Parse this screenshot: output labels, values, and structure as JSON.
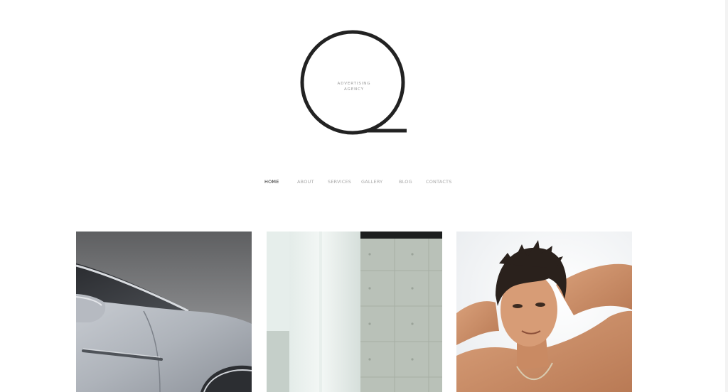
{
  "logo": {
    "letter_mark": "Q",
    "line1": "ADVERTISING",
    "line2": "AGENCY"
  },
  "nav": {
    "items": [
      {
        "label": "HOME",
        "active": true
      },
      {
        "label": "ABOUT",
        "active": false
      },
      {
        "label": "SERVICES",
        "active": false
      },
      {
        "label": "GALLERY",
        "active": false
      },
      {
        "label": "BLOG",
        "active": false
      },
      {
        "label": "CONTACTS",
        "active": false
      }
    ]
  },
  "gallery": {
    "tiles": [
      {
        "subject": "silver car close-up"
      },
      {
        "subject": "white column and concrete wall"
      },
      {
        "subject": "portrait of a man with dark spiky hair"
      }
    ]
  },
  "colors": {
    "background": "#ffffff",
    "logo_stroke": "#222222",
    "nav_active": "#222222",
    "nav_inactive": "#a8a8a8"
  }
}
